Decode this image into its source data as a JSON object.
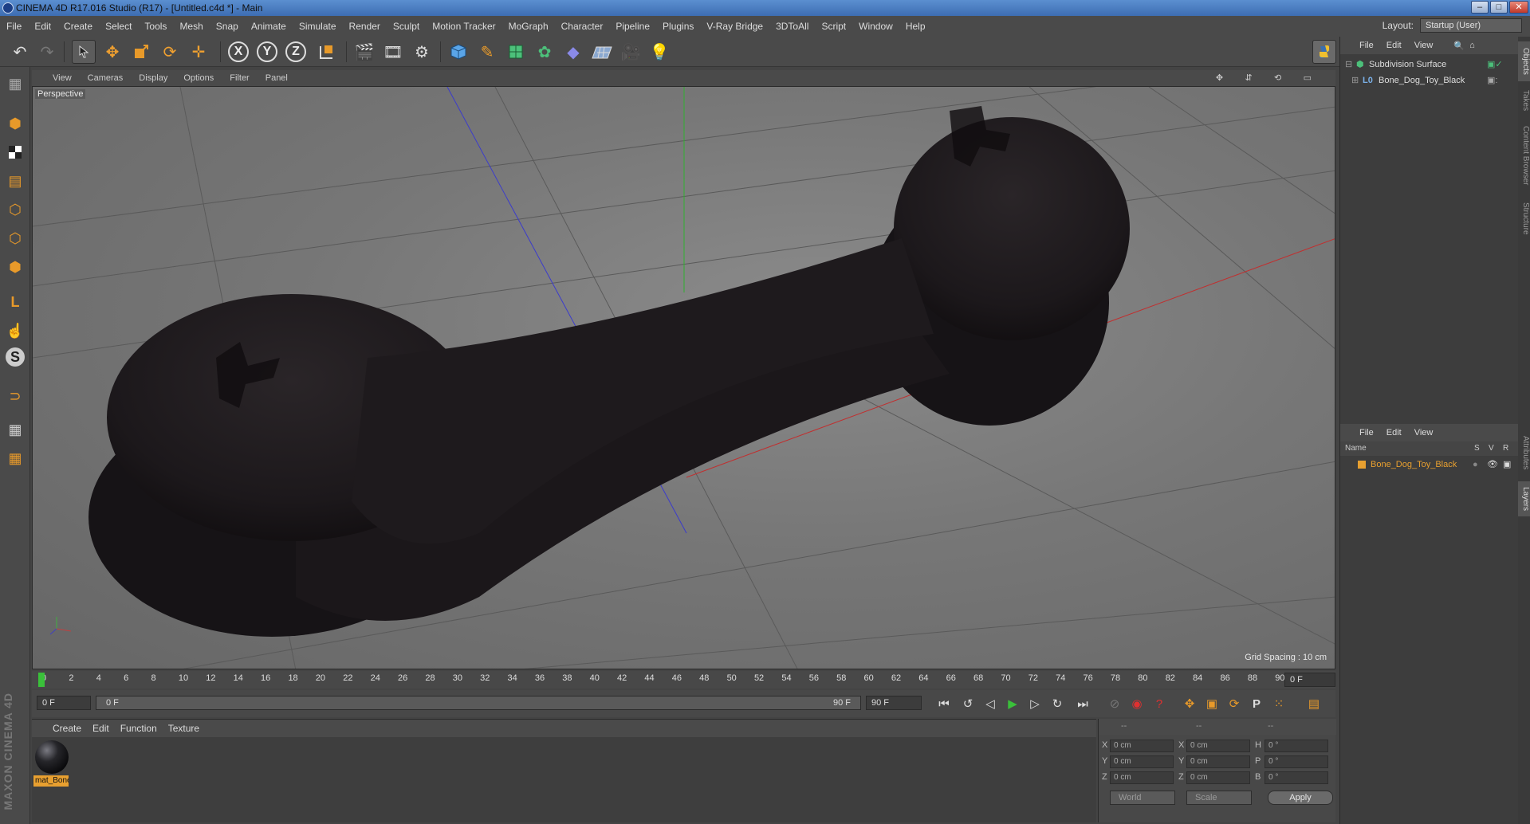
{
  "window": {
    "title": "CINEMA 4D R17.016 Studio (R17) - [Untitled.c4d *] - Main",
    "controls": [
      "–",
      "□",
      "✕"
    ]
  },
  "menubar": {
    "items": [
      "File",
      "Edit",
      "Create",
      "Select",
      "Tools",
      "Mesh",
      "Snap",
      "Animate",
      "Simulate",
      "Render",
      "Sculpt",
      "Motion Tracker",
      "MoGraph",
      "Character",
      "Pipeline",
      "Plugins",
      "V-Ray Bridge",
      "3DToAll",
      "Script",
      "Window",
      "Help"
    ],
    "layout_label": "Layout:",
    "layout_value": "Startup (User)"
  },
  "toolbar": {
    "icons": [
      "undo-icon",
      "redo-icon",
      "select-arrow-icon",
      "move-icon",
      "scale-icon",
      "rotate-icon",
      "transform-icon",
      "x-axis-lock",
      "y-axis-lock",
      "z-axis-lock",
      "coordinate-system-icon",
      "render-view-icon",
      "render-picture-viewer-icon",
      "render-settings-icon",
      "cube-primitive-icon",
      "pen-spline-icon",
      "subdivision-icon",
      "array-icon",
      "deformer-icon",
      "floor-icon",
      "camera-icon",
      "light-icon",
      "python-icon"
    ],
    "axis_x": "X",
    "axis_y": "Y",
    "axis_z": "Z"
  },
  "viewport": {
    "menu": [
      "View",
      "Cameras",
      "Display",
      "Options",
      "Filter",
      "Panel"
    ],
    "camera_label": "Perspective",
    "grid_spacing": "Grid Spacing : 10 cm",
    "nav_icons": [
      "move-view-icon",
      "zoom-view-icon",
      "rotate-view-icon",
      "maximize-view-icon"
    ]
  },
  "timeline": {
    "ticks": [
      "0",
      "2",
      "4",
      "6",
      "8",
      "10",
      "12",
      "14",
      "16",
      "18",
      "20",
      "22",
      "24",
      "26",
      "28",
      "30",
      "32",
      "34",
      "36",
      "38",
      "40",
      "42",
      "44",
      "46",
      "48",
      "50",
      "52",
      "54",
      "56",
      "58",
      "60",
      "62",
      "64",
      "66",
      "68",
      "70",
      "72",
      "74",
      "76",
      "78",
      "80",
      "82",
      "84",
      "86",
      "88",
      "90"
    ],
    "current_frame": "0 F",
    "start_frame": "0 F",
    "range_start": "0 F",
    "range_end": "90 F",
    "end_frame": "90 F"
  },
  "materials": {
    "menu": [
      "Create",
      "Edit",
      "Function",
      "Texture"
    ],
    "items": [
      {
        "name": "mat_Bone"
      }
    ]
  },
  "coordinates": {
    "header": [
      "--",
      "--",
      "--"
    ],
    "rows": [
      {
        "a_label": "X",
        "a_val": "0 cm",
        "b_label": "X",
        "b_val": "0 cm",
        "c_label": "H",
        "c_val": "0 °"
      },
      {
        "a_label": "Y",
        "a_val": "0 cm",
        "b_label": "Y",
        "b_val": "0 cm",
        "c_label": "P",
        "c_val": "0 °"
      },
      {
        "a_label": "Z",
        "a_val": "0 cm",
        "b_label": "Z",
        "b_val": "0 cm",
        "c_label": "B",
        "c_val": "0 °"
      }
    ],
    "mode_select": "World",
    "scale_select": "Scale",
    "apply_label": "Apply"
  },
  "object_manager": {
    "menu": [
      "File",
      "Edit",
      "View"
    ],
    "objects": [
      {
        "name": "Subdivision Surface",
        "color": "#7ad07a"
      },
      {
        "name": "Bone_Dog_Toy_Black",
        "color": "#cfcfcf"
      }
    ]
  },
  "layer_manager": {
    "menu": [
      "File",
      "Edit",
      "View"
    ],
    "col_name": "Name",
    "col_s": "S",
    "col_v": "V",
    "col_r": "R",
    "rows": [
      {
        "name": "Bone_Dog_Toy_Black",
        "color": "#e8a030"
      }
    ]
  },
  "side_tabs": [
    "Objects",
    "Takes",
    "Content Browser",
    "Structure",
    "Attributes",
    "Layers"
  ],
  "logo": "MAXON CINEMA 4D",
  "colors": {
    "accent_orange": "#e8a030",
    "selection_blue": "#4f7fbf",
    "viewport_bg": "#7d7d7d",
    "object_color": "#1d191c"
  }
}
